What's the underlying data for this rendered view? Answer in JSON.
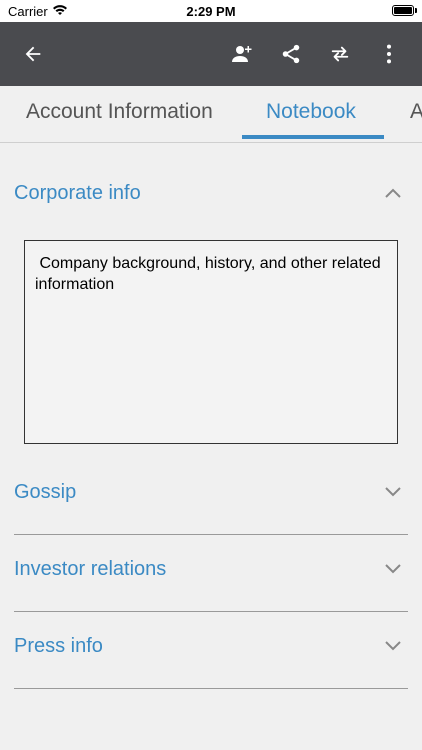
{
  "status_bar": {
    "carrier": "Carrier",
    "time": "2:29 PM"
  },
  "toolbar": {
    "back_icon": "arrow-left-icon",
    "add_contact_icon": "person-add-icon",
    "share_icon": "share-icon",
    "swap_icon": "swap-arrows-icon",
    "more_icon": "more-vertical-icon"
  },
  "tabs": [
    {
      "label": "Account Information",
      "active": false
    },
    {
      "label": "Notebook",
      "active": true
    },
    {
      "label": "A",
      "active": false
    }
  ],
  "sections": {
    "corporate": {
      "title": "Corporate info",
      "expanded": true,
      "notes": " Company background, history, and other related information"
    },
    "gossip": {
      "title": "Gossip",
      "expanded": false
    },
    "investor": {
      "title": "Investor relations",
      "expanded": false
    },
    "press": {
      "title": "Press info",
      "expanded": false
    }
  },
  "colors": {
    "accent": "#3b8ac4",
    "toolbar": "#4a4b4f",
    "background": "#f0f0f0"
  }
}
